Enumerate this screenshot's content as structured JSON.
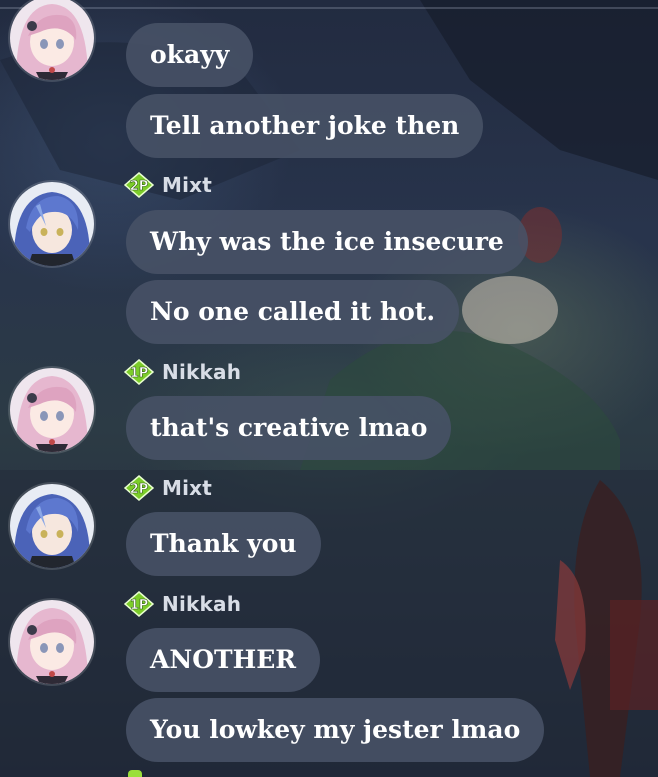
{
  "colors": {
    "bubble_background": "#485266",
    "bubble_text": "#ffffff",
    "sender_name": "#d8dde6",
    "badge_green": "#7ccc2a"
  },
  "messages": [
    {
      "sender": "",
      "player_badge": "",
      "avatar": "nikkah-avatar",
      "text": "okayy"
    },
    {
      "sender": "",
      "player_badge": "",
      "avatar": "nikkah-avatar",
      "text": "Tell another joke then"
    },
    {
      "sender": "Mixt",
      "player_badge": "2P",
      "avatar": "mixt-avatar",
      "text": "Why was the ice insecure"
    },
    {
      "sender": "Mixt",
      "player_badge": "2P",
      "avatar": "mixt-avatar",
      "text": "No one called it hot."
    },
    {
      "sender": "Nikkah",
      "player_badge": "1P",
      "avatar": "nikkah-avatar",
      "text": "that's creative lmao"
    },
    {
      "sender": "Mixt",
      "player_badge": "2P",
      "avatar": "mixt-avatar",
      "text": "Thank you"
    },
    {
      "sender": "Nikkah",
      "player_badge": "1P",
      "avatar": "nikkah-avatar",
      "text": "ANOTHER"
    },
    {
      "sender": "Nikkah",
      "player_badge": "1P",
      "avatar": "nikkah-avatar",
      "text": "You lowkey my jester lmao"
    }
  ]
}
